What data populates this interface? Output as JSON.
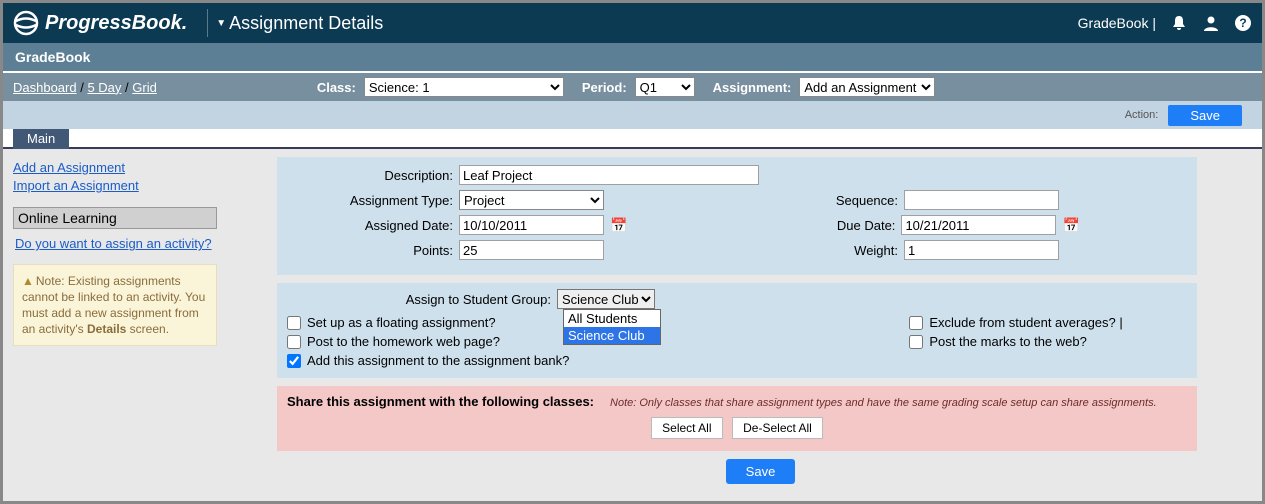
{
  "topbar": {
    "brand": "ProgressBook.",
    "page_title": "Assignment Details",
    "right_text": "GradeBook |"
  },
  "subhead": "GradeBook",
  "breadcrumbs": {
    "dashboard": "Dashboard",
    "five_day": "5 Day",
    "grid": "Grid",
    "sep": " / "
  },
  "navbar": {
    "class_label": "Class:",
    "class_value": "Science: 1",
    "period_label": "Period:",
    "period_value": "Q1",
    "assignment_label": "Assignment:",
    "assignment_value": "Add an Assignment"
  },
  "action_row": {
    "action_label": "Action:",
    "save": "Save"
  },
  "tab_main": "Main",
  "sidebar": {
    "add_assignment": "Add an Assignment",
    "import_assignment": "Import an Assignment",
    "online_learning_header": "Online Learning",
    "assign_activity_q": "Do you want to assign an activity?",
    "note": "Note: Existing assignments cannot be linked to an activity. You must add a new assignment from an activity's ",
    "note_bold": "Details",
    "note_tail": " screen."
  },
  "form": {
    "description_label": "Description:",
    "description_value": "Leaf Project",
    "type_label": "Assignment Type:",
    "type_value": "Project",
    "assigned_date_label": "Assigned Date:",
    "assigned_date_value": "10/10/2011",
    "points_label": "Points:",
    "points_value": "25",
    "sequence_label": "Sequence:",
    "sequence_value": "",
    "due_date_label": "Due Date:",
    "due_date_value": "10/21/2011",
    "weight_label": "Weight:",
    "weight_value": "1"
  },
  "group": {
    "label": "Assign to Student Group:",
    "selected": "Science Club",
    "options": [
      "All Students",
      "Science Club"
    ],
    "chk_floating": "Set up as a floating assignment?",
    "chk_post_hw": "Post to the homework web page?",
    "chk_bank": "Add this assignment to the assignment bank?",
    "chk_exclude": "Exclude from student averages?",
    "chk_post_marks": "Post the marks to the web?"
  },
  "share": {
    "title": "Share this assignment with the following classes:",
    "note": "Note: Only classes that share assignment types and have the same grading scale setup can share assignments.",
    "select_all": "Select All",
    "deselect_all": "De-Select All"
  },
  "bottom_save": "Save"
}
